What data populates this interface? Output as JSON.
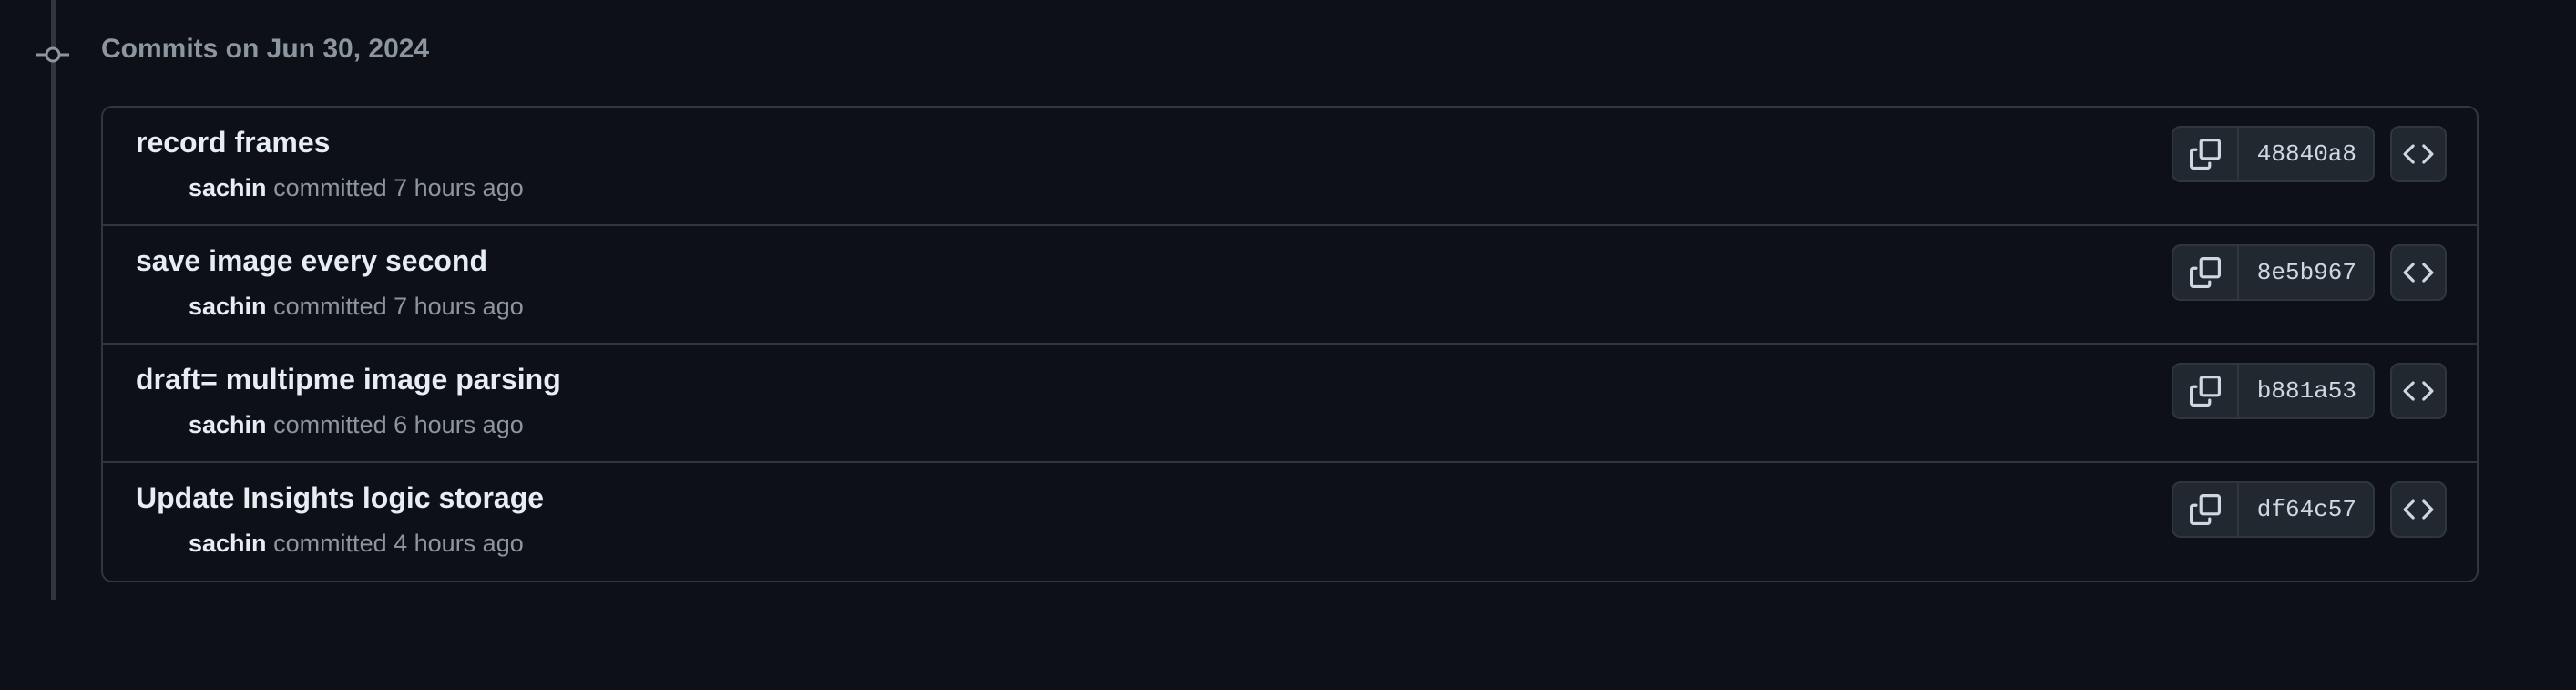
{
  "group": {
    "heading": "Commits on Jun 30, 2024",
    "node_icon": "git-commit-icon"
  },
  "commits": [
    {
      "title": "record frames",
      "author": "sachin",
      "action": "committed",
      "time": "7 hours ago",
      "sha": "48840a8",
      "copy_icon": "copy-icon",
      "browse_icon": "code-icon"
    },
    {
      "title": "save image every second",
      "author": "sachin",
      "action": "committed",
      "time": "7 hours ago",
      "sha": "8e5b967",
      "copy_icon": "copy-icon",
      "browse_icon": "code-icon"
    },
    {
      "title": "draft= multipme image parsing",
      "author": "sachin",
      "action": "committed",
      "time": "6 hours ago",
      "sha": "b881a53",
      "copy_icon": "copy-icon",
      "browse_icon": "code-icon"
    },
    {
      "title": "Update Insights logic storage",
      "author": "sachin",
      "action": "committed",
      "time": "4 hours ago",
      "sha": "df64c57",
      "copy_icon": "copy-icon",
      "browse_icon": "code-icon"
    }
  ],
  "colors": {
    "background": "#0d1117",
    "border": "#30363d",
    "text_primary": "#e6edf3",
    "text_muted": "#8d96a0",
    "button_bg": "#212830"
  }
}
